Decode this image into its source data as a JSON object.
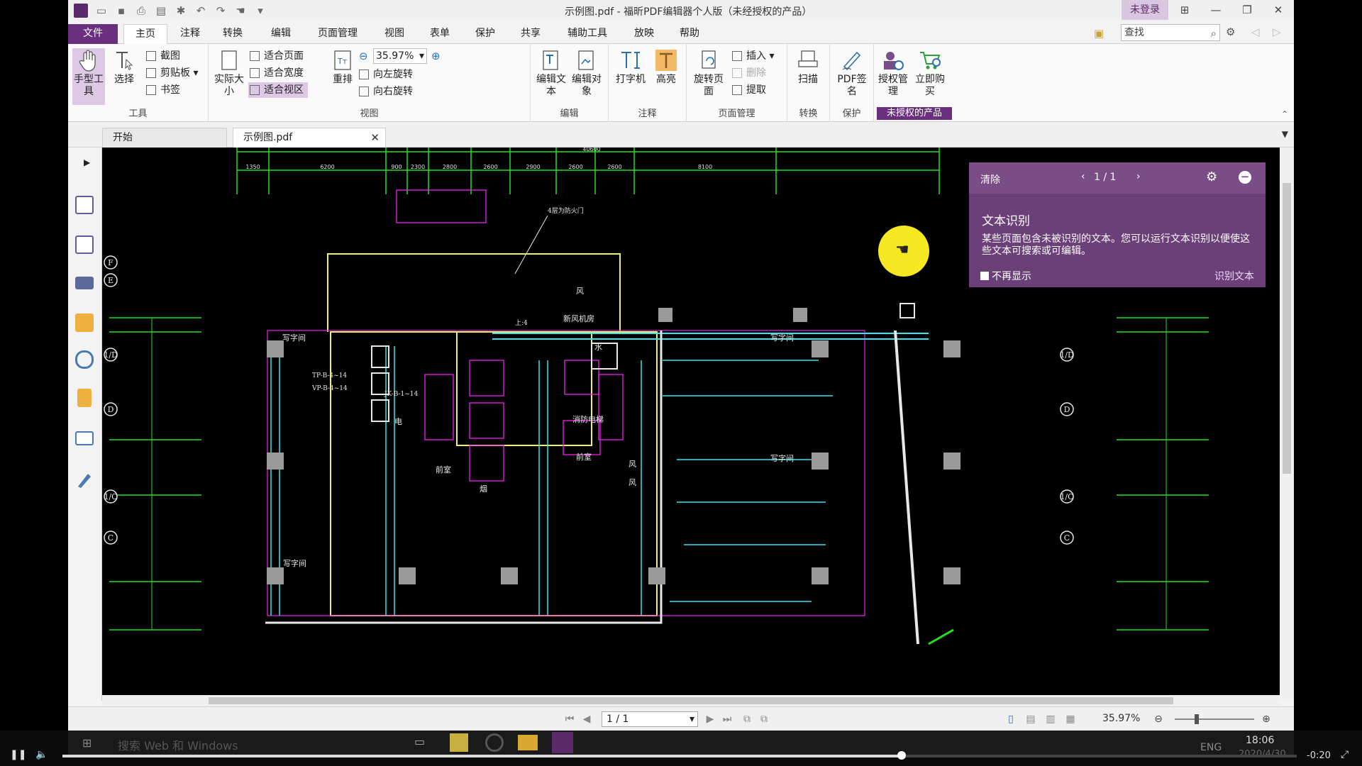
{
  "window": {
    "title": "示例图.pdf - 福昕PDF编辑器个人版（未经授权的产品）",
    "login": "未登录"
  },
  "menu": {
    "tabs": [
      "文件",
      "主页",
      "注释",
      "转换",
      "编辑",
      "页面管理",
      "视图",
      "表单",
      "保护",
      "共享",
      "辅助工具",
      "放映",
      "帮助"
    ],
    "search_placeholder": "查找"
  },
  "ribbon": {
    "tools": {
      "label": "工具",
      "hand": "手型工具",
      "select": "选择",
      "screenshot": "截图",
      "clipboard": "剪贴板",
      "bookmark": "书签"
    },
    "view": {
      "label": "视图",
      "actual_size": "实际大小",
      "fit_page": "适合页面",
      "fit_width": "适合宽度",
      "fit_view": "适合视区",
      "reflow": "重排",
      "zoom_value": "35.97%",
      "rotate_left": "向左旋转",
      "rotate_right": "向右旋转"
    },
    "edit": {
      "label": "编辑",
      "edit_text": "编辑文本",
      "edit_object": "编辑对象"
    },
    "comment": {
      "label": "注释",
      "typewriter": "打字机",
      "highlight": "高亮"
    },
    "page": {
      "label": "页面管理",
      "rotate_page": "旋转页面",
      "insert": "插入",
      "delete": "删除",
      "extract": "提取"
    },
    "convert": {
      "label": "转换",
      "scan": "扫描"
    },
    "protect": {
      "label": "保护",
      "pdf_sign": "PDF签名"
    },
    "unauthorized": {
      "label": "未授权的产品",
      "license": "授权管理",
      "buy": "立即购买"
    }
  },
  "doc_tabs": [
    "开始",
    "示例图.pdf"
  ],
  "ocr_popup": {
    "clear": "清除",
    "page": "1 / 1",
    "title": "文本识别",
    "description": "某些页面包含未被识别的文本。您可以运行文本识别以便使这些文本可搜索或可编辑。",
    "dont_show": "不再显示",
    "action": "识别文本"
  },
  "status": {
    "page": "1 / 1",
    "zoom": "35.97%"
  },
  "drawing": {
    "dims_top": [
      "1350",
      "6200",
      "900",
      "2300",
      "2800",
      "2600",
      "2900",
      "2600",
      "2600",
      "8100"
    ],
    "overall_dim": "40600",
    "axis_labels_left": [
      "F",
      "E",
      "1/D",
      "D",
      "1/C",
      "C"
    ],
    "rooms": [
      "写字间",
      "写字间",
      "写字间",
      "新风机房",
      "消防电梯",
      "前室",
      "前室",
      "电",
      "水",
      "风",
      "风",
      "风",
      "烟",
      "写字间"
    ],
    "notes": [
      "4层为防火门",
      "TP-B-4~14",
      "VP-B-4~14",
      "JK-B-1~14",
      "上:4"
    ]
  },
  "taskbar": {
    "search": "搜索 Web 和 Windows",
    "time": "18:06",
    "date": "2020/4/30",
    "lang": "ENG"
  },
  "player": {
    "progress": 0.68,
    "remaining": "-0:20"
  },
  "colors": {
    "accent": "#6b2f7f",
    "drawing_green": "#20e020",
    "drawing_cyan": "#30e8f0",
    "drawing_yellow": "#f0f060",
    "drawing_magenta": "#f020f0"
  }
}
